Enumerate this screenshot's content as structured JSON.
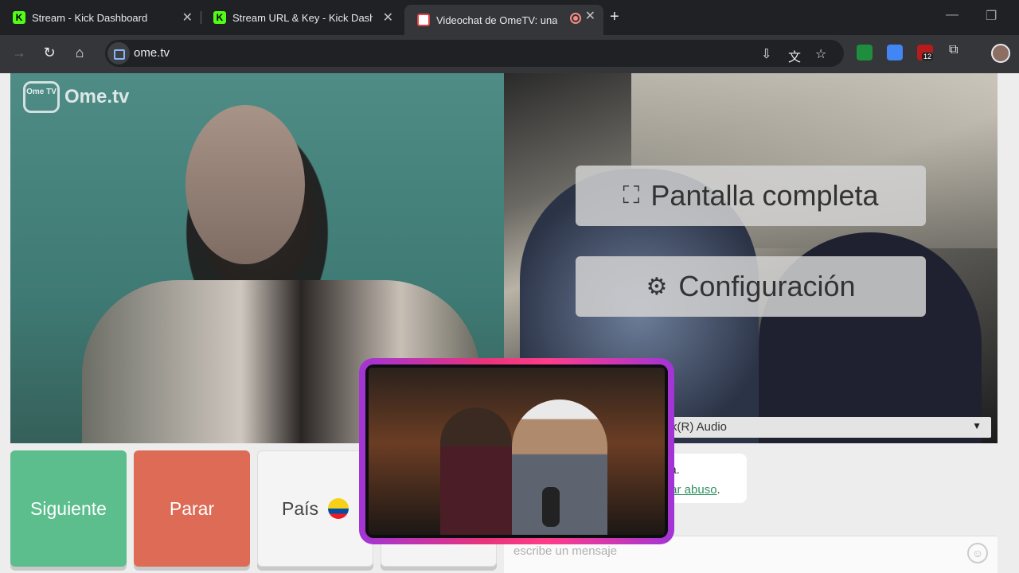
{
  "browser": {
    "tabs": [
      {
        "title": "Stream - Kick Dashboard",
        "favicon": "kick-icon"
      },
      {
        "title": "Stream URL & Key - Kick Dashb",
        "favicon": "kick-icon"
      },
      {
        "title": "Videochat de OmeTV: una",
        "favicon": "ometv-icon",
        "active": true,
        "recording": true
      }
    ],
    "url": "ome.tv",
    "extension_badge": "12"
  },
  "ometv": {
    "logo_text": "Ome.tv",
    "logo_badge": "Ome TV",
    "overlay": {
      "fullscreen_label": "Pantalla completa",
      "settings_label": "Configuración"
    },
    "device_select_value": "k(R) Audio",
    "buttons": {
      "next": "Siguiente",
      "stop": "Parar",
      "country": "País"
    },
    "chat": {
      "message_line1": "da.",
      "message_link": "rtar abuso",
      "message_suffix": ".",
      "input_placeholder": "escribe un mensaje"
    }
  },
  "colors": {
    "next": "#5cbd8d",
    "stop": "#dd6b55",
    "webcam_border_start": "#a234d6",
    "webcam_border_mid": "#ff3d8b"
  }
}
